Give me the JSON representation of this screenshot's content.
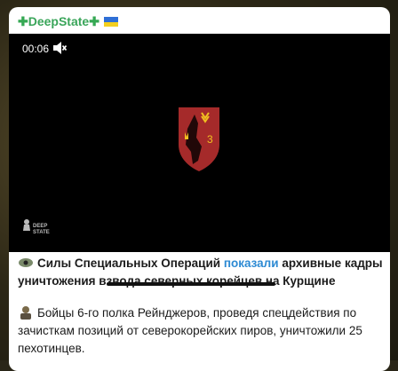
{
  "post": {
    "channel_name": "DeepState",
    "plus_left": "✚",
    "plus_right": "✚",
    "flag_icon": "ukraine-flag-icon",
    "video": {
      "time": "00:06",
      "mute_icon": "mute-icon",
      "watermark_line1": "DEEP",
      "watermark_line2": "STATE",
      "emblem_label": "3"
    },
    "paragraph1": {
      "prefix": "Силы Специальных Операций ",
      "link": "показали",
      "rest": " архивные кадры уничтожения взвода северных корейцев на Курщине"
    },
    "paragraph2": {
      "text": "Бойцы 6-го полка Рейнджеров, проведя спецдействия по зачисткам позиций от северокорейских пиров, уничтожили 25 пехотинцев."
    },
    "colors": {
      "channel": "#3aa55a",
      "link": "#2d8ad3",
      "emblem_red": "#a52a2a"
    }
  }
}
